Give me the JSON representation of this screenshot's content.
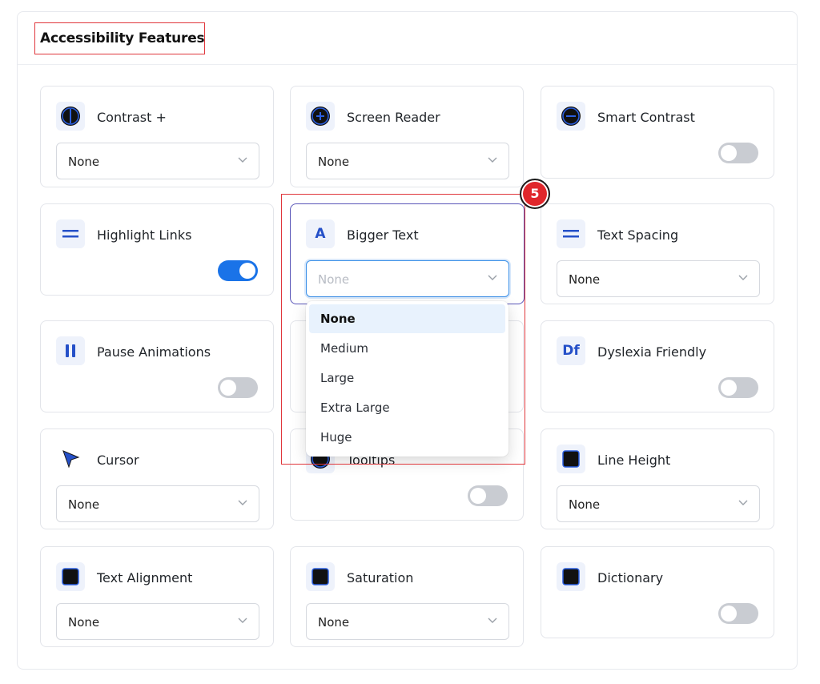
{
  "section": {
    "title": "Accessibility Features"
  },
  "cards": {
    "contrast": {
      "label": "Contrast +",
      "value": "None"
    },
    "screen_reader": {
      "label": "Screen Reader",
      "value": "None"
    },
    "smart_contrast": {
      "label": "Smart Contrast",
      "toggle": false
    },
    "highlight_links": {
      "label": "Highlight Links",
      "toggle": true
    },
    "bigger_text": {
      "label": "Bigger Text",
      "placeholder": "None"
    },
    "text_spacing": {
      "label": "Text Spacing",
      "value": "None"
    },
    "pause_animations": {
      "label": "Pause Animations",
      "toggle": false
    },
    "dyslexia_friendly": {
      "label": "Dyslexia Friendly",
      "icon_text": "Df",
      "toggle": false
    },
    "cursor": {
      "label": "Cursor",
      "value": "None"
    },
    "tooltips": {
      "label": "Tooltips",
      "toggle": false
    },
    "line_height": {
      "label": "Line Height",
      "value": "None"
    },
    "text_alignment": {
      "label": "Text Alignment",
      "value": "None"
    },
    "saturation": {
      "label": "Saturation",
      "value": "None"
    },
    "dictionary": {
      "label": "Dictionary",
      "toggle": false
    }
  },
  "bigger_text_icon": "A",
  "dropdown": {
    "options": [
      "None",
      "Medium",
      "Large",
      "Extra Large",
      "Huge"
    ],
    "selected": "None"
  },
  "annotation": {
    "step": "5"
  },
  "colors": {
    "accent": "#1a73e8",
    "icon": "#2550c8",
    "highlight": "#e0373c",
    "badge": "#e0262b"
  },
  "icons": {
    "contrast": "contrast-icon",
    "screen_reader": "plus-circle-icon",
    "smart_contrast": "minus-circle-icon",
    "highlight_links": "equals-icon",
    "bigger_text": "letter-a-icon",
    "text_spacing": "equals-icon",
    "pause_animations": "pause-icon",
    "dyslexia_friendly": "df-icon",
    "cursor": "cursor-arrow-icon",
    "tooltips": "tooltip-icon",
    "line_height": "square-icon",
    "text_alignment": "square-icon",
    "saturation": "square-icon",
    "dictionary": "square-icon",
    "chevron": "chevron-down-icon"
  }
}
